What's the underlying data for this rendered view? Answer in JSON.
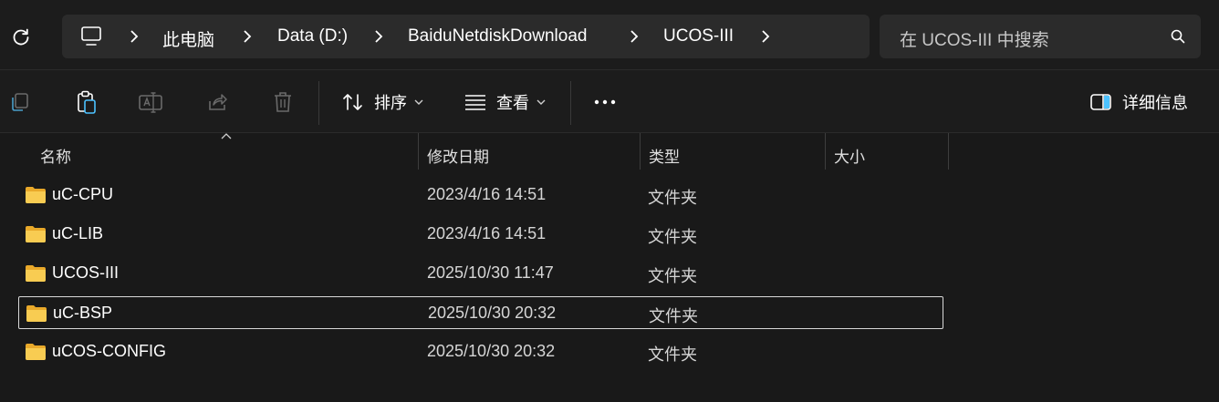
{
  "address_bar": {
    "breadcrumbs": [
      "此电脑",
      "Data (D:)",
      "BaiduNetdiskDownload",
      "UCOS-III"
    ]
  },
  "search": {
    "placeholder": "在 UCOS-III 中搜索"
  },
  "command_bar": {
    "sort_label": "排序",
    "view_label": "查看",
    "details_label": "详细信息"
  },
  "columns": {
    "name": "名称",
    "date": "修改日期",
    "type": "类型",
    "size": "大小"
  },
  "files": [
    {
      "name": "uC-CPU",
      "date": "2023/4/16 14:51",
      "type": "文件夹"
    },
    {
      "name": "uC-LIB",
      "date": "2023/4/16 14:51",
      "type": "文件夹"
    },
    {
      "name": "UCOS-III",
      "date": "2025/10/30 11:47",
      "type": "文件夹"
    },
    {
      "name": "uC-BSP",
      "date": "2025/10/30 20:32",
      "type": "文件夹",
      "selected": true
    },
    {
      "name": "uCOS-CONFIG",
      "date": "2025/10/30 20:32",
      "type": "文件夹"
    }
  ],
  "colors": {
    "background": "#191919",
    "folder": "#f4c542",
    "accent": "#4cc2ff"
  }
}
